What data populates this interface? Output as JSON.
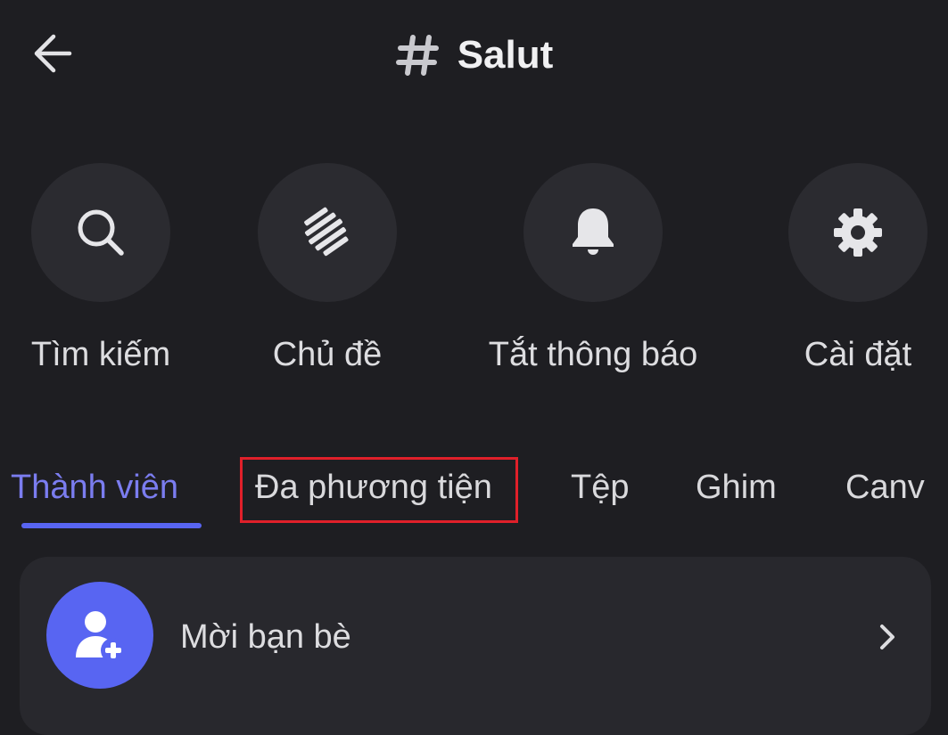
{
  "header": {
    "back_icon": "arrow-left-icon",
    "channel_icon": "hash-icon",
    "title": "Salut"
  },
  "actions": [
    {
      "label": "Tìm kiếm",
      "icon": "search-icon"
    },
    {
      "label": "Chủ đề",
      "icon": "threads-icon"
    },
    {
      "label": "Tắt thông báo",
      "icon": "bell-icon"
    },
    {
      "label": "Cài đặt",
      "icon": "gear-icon"
    }
  ],
  "tabs": [
    {
      "label": "Thành viên",
      "active": true
    },
    {
      "label": "Đa phương tiện",
      "active": false,
      "highlighted": true
    },
    {
      "label": "Tệp",
      "active": false
    },
    {
      "label": "Ghim",
      "active": false
    },
    {
      "label": "Canv",
      "active": false
    }
  ],
  "invite": {
    "label": "Mời bạn bè",
    "icon": "add-user-icon",
    "chevron_icon": "chevron-right-icon"
  },
  "colors": {
    "background": "#1e1e22",
    "accent": "#5865f2",
    "active_tab_text": "#7b7df0",
    "highlight_border": "#e0202a"
  }
}
